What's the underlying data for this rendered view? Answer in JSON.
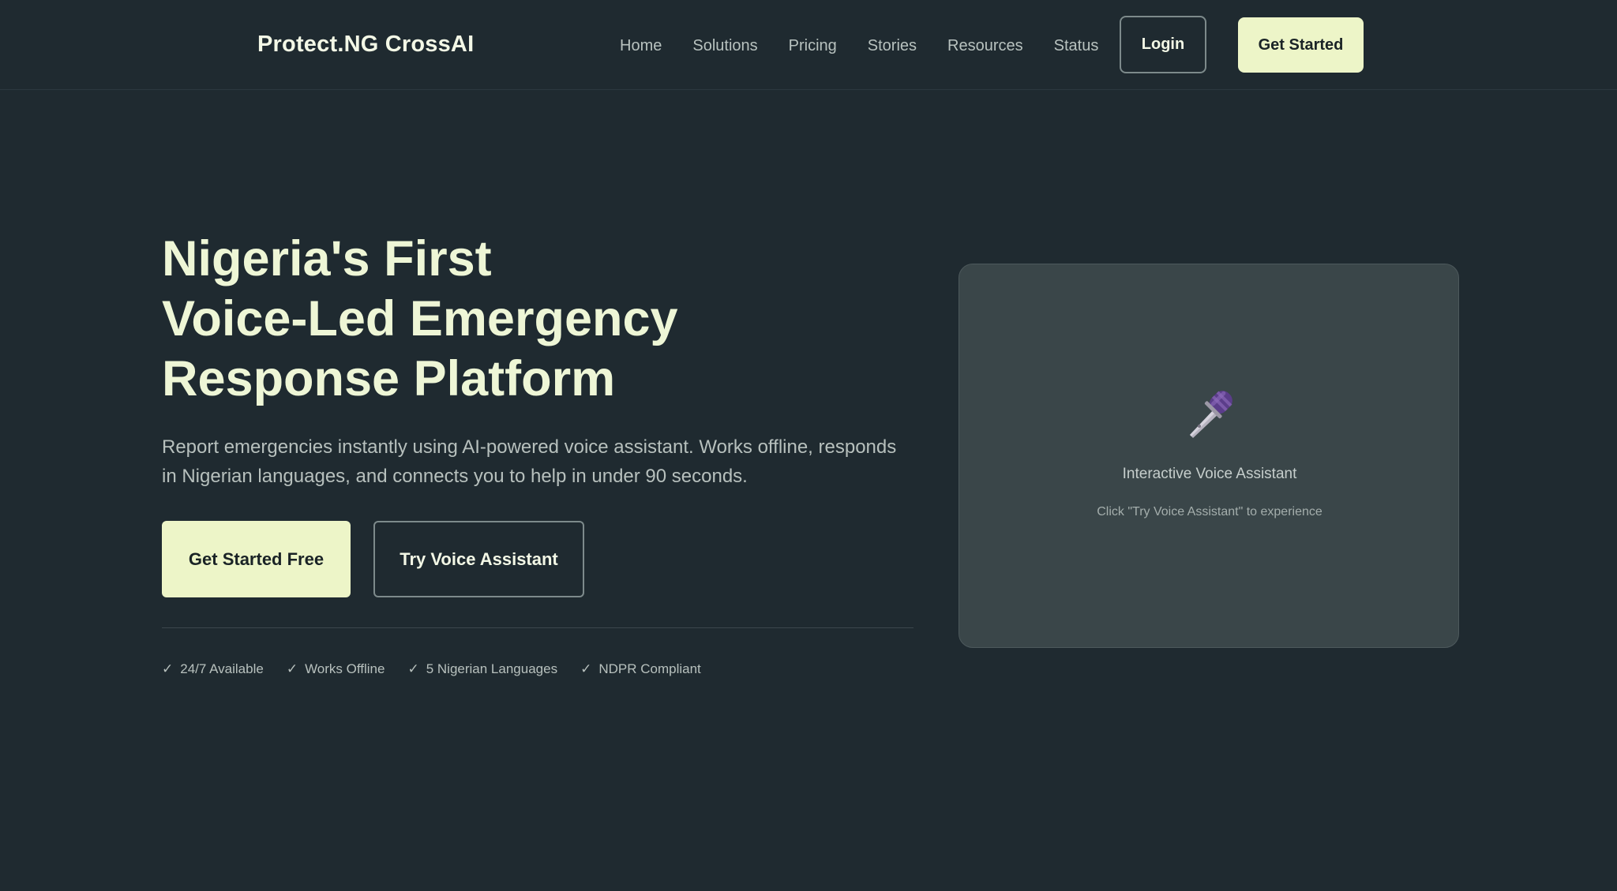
{
  "brand": "Protect.NG CrossAI",
  "nav": {
    "items": [
      "Home",
      "Solutions",
      "Pricing",
      "Stories",
      "Resources",
      "Status"
    ],
    "login_label": "Login",
    "get_started_label": "Get Started"
  },
  "hero": {
    "title_lines": [
      "Nigeria's First",
      "Voice-Led Emergency",
      "Response Platform"
    ],
    "subtitle": "Report emergencies instantly using AI-powered voice assistant. Works offline, responds in Nigerian languages, and connects you to help in under 90 seconds.",
    "cta_primary": "Get Started Free",
    "cta_secondary": "Try Voice Assistant",
    "features": [
      "24/7 Available",
      "Works Offline",
      "5 Nigerian Languages",
      "NDPR Compliant"
    ],
    "check_glyph": "✓"
  },
  "voice_card": {
    "icon": "microphone-icon",
    "title": "Interactive Voice Assistant",
    "hint": "Click \"Try Voice Assistant\" to experience"
  },
  "colors": {
    "background": "#1f2a30",
    "accent": "#edf5c8",
    "card": "#3a4649",
    "mic_purple": "#5b3d8a"
  }
}
